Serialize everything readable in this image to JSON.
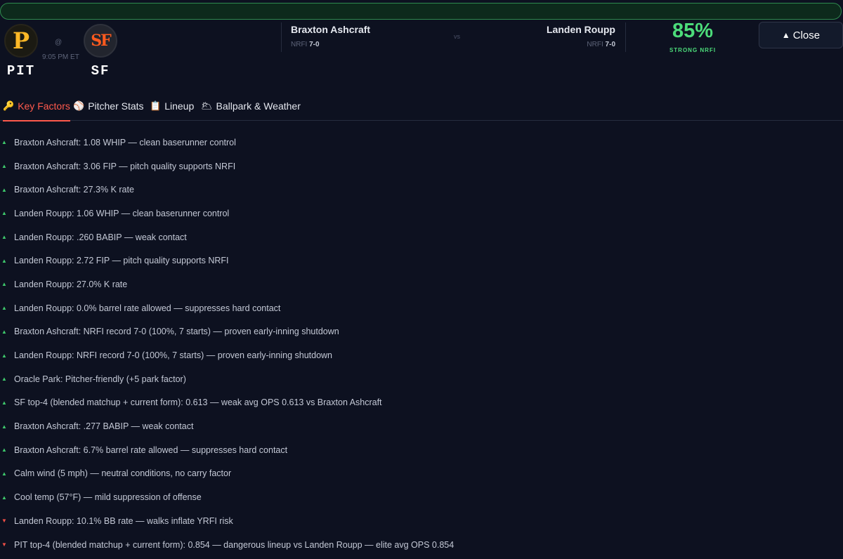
{
  "away": {
    "abbr": "PIT",
    "logo_glyph": "P"
  },
  "home": {
    "abbr": "SF",
    "logo_glyph": "SF"
  },
  "matchup": {
    "at": "@",
    "time": "9:05 PM ET",
    "vs": "vs"
  },
  "pitchers": {
    "away": {
      "name": "Braxton Ashcraft",
      "rec_label": "NRFI",
      "rec_value": "7-0"
    },
    "home": {
      "name": "Landen Roupp",
      "rec_label": "NRFI",
      "rec_value": "7-0"
    }
  },
  "prediction": {
    "pct": "85%",
    "label": "STRONG NRFI",
    "color": "#4cdc7a"
  },
  "close_button": {
    "icon": "▲",
    "label": "Close"
  },
  "tabs": [
    {
      "icon": "🔑",
      "label": "Key Factors",
      "active": true
    },
    {
      "icon": "⚾",
      "label": "Pitcher Stats"
    },
    {
      "icon": "📋",
      "label": "Lineup"
    },
    {
      "icon": "🌥",
      "label": "Ballpark & Weather"
    }
  ],
  "factors": [
    {
      "dir": "up",
      "text": "Braxton Ashcraft: 1.08 WHIP — clean baserunner control"
    },
    {
      "dir": "up",
      "text": "Braxton Ashcraft: 3.06 FIP — pitch quality supports NRFI"
    },
    {
      "dir": "up",
      "text": "Braxton Ashcraft: 27.3% K rate"
    },
    {
      "dir": "up",
      "text": "Landen Roupp: 1.06 WHIP — clean baserunner control"
    },
    {
      "dir": "up",
      "text": "Landen Roupp: .260 BABIP — weak contact"
    },
    {
      "dir": "up",
      "text": "Landen Roupp: 2.72 FIP — pitch quality supports NRFI"
    },
    {
      "dir": "up",
      "text": "Landen Roupp: 27.0% K rate"
    },
    {
      "dir": "up",
      "text": "Landen Roupp: 0.0% barrel rate allowed — suppresses hard contact"
    },
    {
      "dir": "up",
      "text": "Braxton Ashcraft: NRFI record 7-0 (100%, 7 starts) — proven early-inning shutdown"
    },
    {
      "dir": "up",
      "text": "Landen Roupp: NRFI record 7-0 (100%, 7 starts) — proven early-inning shutdown"
    },
    {
      "dir": "up",
      "text": "Oracle Park: Pitcher-friendly (+5 park factor)"
    },
    {
      "dir": "up",
      "text": "SF top-4 (blended matchup + current form): 0.613 — weak avg OPS 0.613 vs Braxton Ashcraft"
    },
    {
      "dir": "up",
      "text": "Braxton Ashcraft: .277 BABIP — weak contact"
    },
    {
      "dir": "up",
      "text": "Braxton Ashcraft: 6.7% barrel rate allowed — suppresses hard contact"
    },
    {
      "dir": "up",
      "text": "Calm wind (5 mph) — neutral conditions, no carry factor"
    },
    {
      "dir": "up",
      "text": "Cool temp (57°F) — mild suppression of offense"
    },
    {
      "dir": "down",
      "text": "Landen Roupp: 10.1% BB rate — walks inflate YRFI risk"
    },
    {
      "dir": "down",
      "text": "PIT top-4 (blended matchup + current form): 0.854 — dangerous lineup vs Landen Roupp — elite avg OPS 0.854"
    }
  ]
}
